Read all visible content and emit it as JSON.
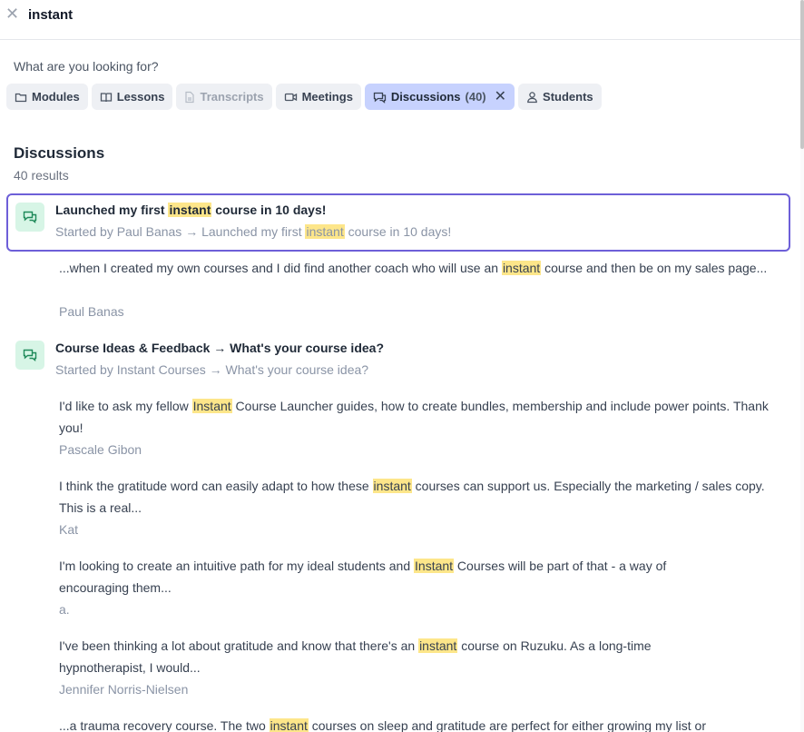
{
  "search": {
    "query": "instant"
  },
  "prompt": "What are you looking for?",
  "filters": {
    "modules": "Modules",
    "lessons": "Lessons",
    "transcripts": "Transcripts",
    "meetings": "Meetings",
    "discussions": "Discussions",
    "discussions_count": "(40)",
    "students": "Students"
  },
  "section": {
    "title": "Discussions",
    "count": "40 results"
  },
  "threads": [
    {
      "title_pre": "Launched my first ",
      "title_hl": "instant",
      "title_post": " course in 10 days!",
      "sub_pre": "Started by Paul Banas → Launched my first ",
      "sub_hl": "instant",
      "sub_post": " course in 10 days!",
      "replies": [
        {
          "pre": "...when I created my own courses and I did find another coach who will use an ",
          "hl": "instant",
          "post": " course and then be on my sales page...",
          "author": "Paul Banas"
        }
      ]
    },
    {
      "title": "Course Ideas & Feedback → What's your course idea?",
      "sub": "Started by Instant Courses → What's your course idea?",
      "replies": [
        {
          "pre": "I'd like to ask my fellow ",
          "hl": "Instant",
          "post": " Course Launcher guides, how to create bundles, membership and include power points. Thank you!",
          "author": "Pascale Gibon"
        },
        {
          "pre": "I think the gratitude word can easily adapt to how these ",
          "hl": "instant",
          "post": " courses can support us. Especially the marketing / sales copy. This is a real...",
          "author": "Kat"
        },
        {
          "pre": "I'm looking to create an intuitive path for my ideal students and ",
          "hl": "Instant",
          "post": " Courses will be part of that - a way of encouraging them...",
          "author": "a."
        },
        {
          "pre": "I've been thinking a lot about gratitude and know that there's an ",
          "hl": "instant",
          "post": " course on Ruzuku. As a long-time hypnotherapist, I would...",
          "author": "Jennifer Norris-Nielsen"
        },
        {
          "pre": "...a trauma recovery course. The two ",
          "hl": "instant",
          "post": " courses on sleep and gratitude are perfect for either growing my list or"
        }
      ]
    }
  ]
}
